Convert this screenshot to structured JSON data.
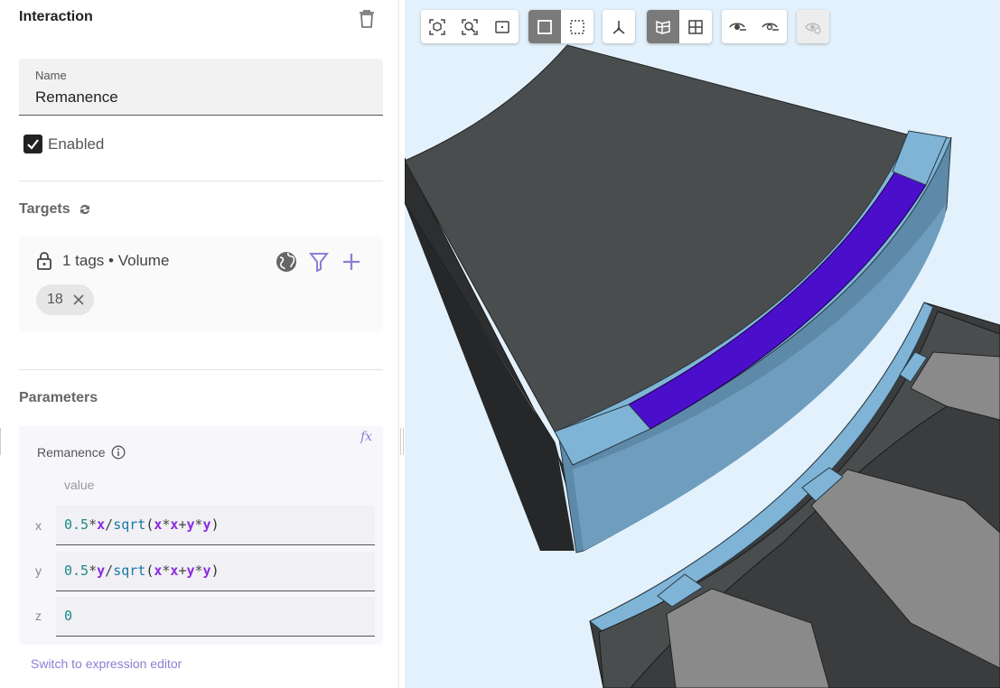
{
  "panel": {
    "title": "Interaction",
    "name_label": "Name",
    "name_value": "Remanence",
    "enabled_label": "Enabled",
    "enabled_checked": true,
    "targets_title": "Targets",
    "targets_summary": "1 tags • Volume",
    "target_chip": "18",
    "parameters_title": "Parameters",
    "parameter_label": "Remanence",
    "column_header": "value",
    "axes": [
      "x",
      "y",
      "z"
    ],
    "switch_link": "Switch to expression editor",
    "fx_label": "fx"
  },
  "toolbar": {
    "group1": [
      "fit-view-icon",
      "zoom-to-selection-icon",
      "frame-icon"
    ],
    "group2": [
      "select-solid-icon",
      "select-box-icon"
    ],
    "group3": [
      "axes-icon"
    ],
    "group4": [
      "section-view-icon",
      "grid-view-icon"
    ],
    "group5": [
      "show-hidden-icon",
      "hide-selected-icon"
    ],
    "group6": [
      "visibility-disabled-icon"
    ]
  },
  "colors": {
    "accent": "#8b7fd6",
    "highlight_volume": "#4b0fcc",
    "body_dark": "#4a4d4e",
    "body_light_blue": "#7fb4d6",
    "viewport_bg": "#e3f1fc"
  }
}
